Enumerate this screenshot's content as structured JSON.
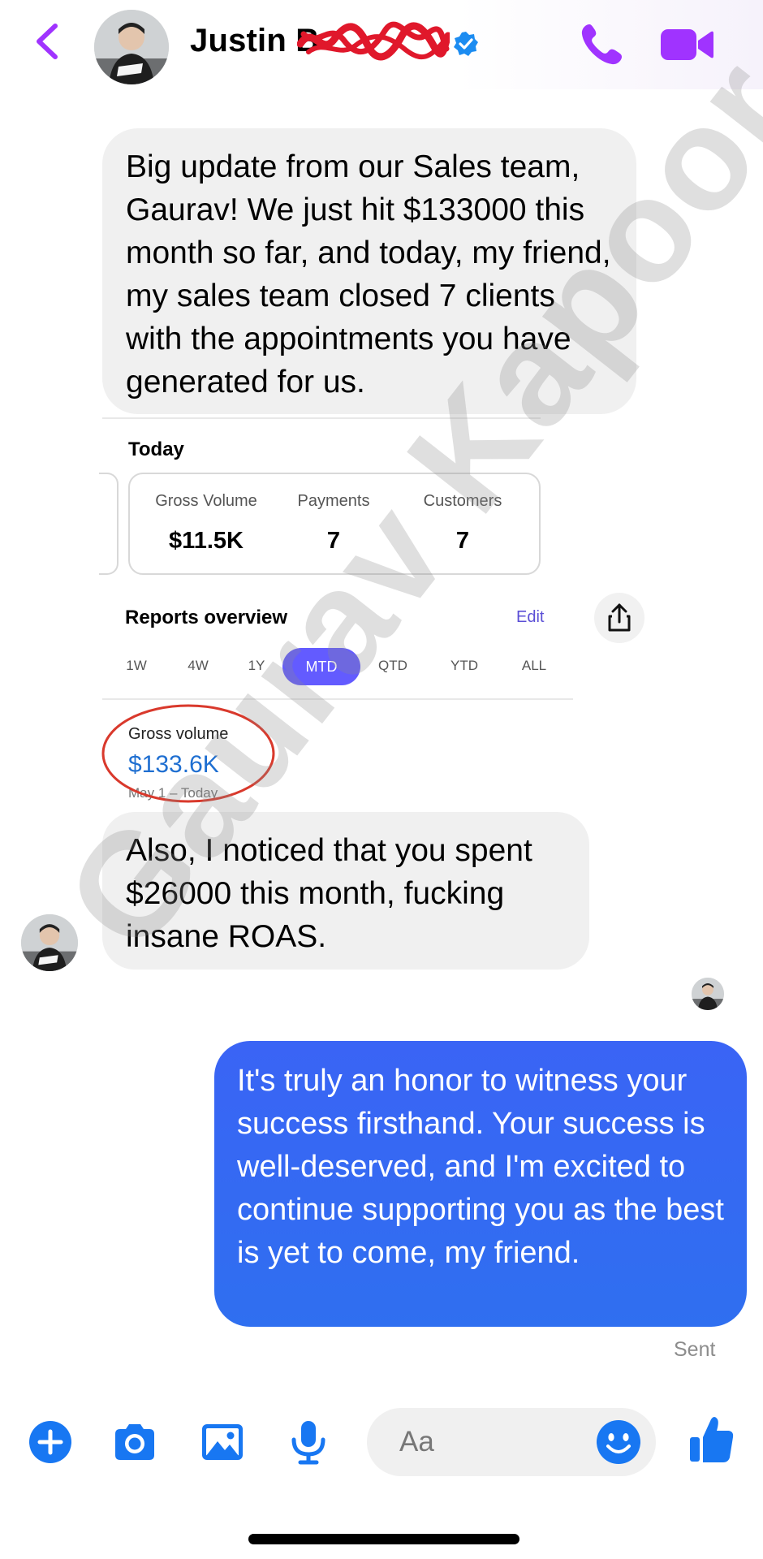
{
  "header": {
    "contact_name": "Justin B",
    "icons": [
      "back-chevron-icon",
      "verified-badge-icon",
      "phone-icon",
      "video-camera-icon"
    ]
  },
  "messages": {
    "incoming_1": "Big update from our Sales team, Gaurav! We just hit $133000 this month so far, and today, my friend, my sales team closed 7 clients with the appointments you have generated for us.",
    "incoming_2": "Also, I noticed that you spent $26000 this month, fucking insane ROAS.",
    "outgoing_1": "It's truly an honor to witness your success firsthand. Your success is well-deserved, and I'm excited to continue supporting you as the best is yet to come, my friend.",
    "status": "Sent"
  },
  "shared_card": {
    "today_title": "Today",
    "stats": [
      {
        "label": "Gross Volume",
        "value": "$11.5K"
      },
      {
        "label": "Payments",
        "value": "7"
      },
      {
        "label": "Customers",
        "value": "7"
      }
    ],
    "reports_title": "Reports overview",
    "edit_label": "Edit",
    "periods": [
      "1W",
      "4W",
      "1Y",
      "MTD",
      "QTD",
      "YTD",
      "ALL"
    ],
    "active_period": "MTD",
    "gross_volume_label": "Gross volume",
    "gross_volume_value": "$133.6K",
    "gross_volume_range": "May 1 – Today"
  },
  "watermark": "Gaurav Kapoor",
  "composer": {
    "placeholder": "Aa",
    "icons": [
      "plus-circle-icon",
      "camera-icon",
      "gallery-icon",
      "microphone-icon",
      "emoji-icon",
      "thumbs-up-icon"
    ]
  },
  "colors": {
    "accent_purple": "#a033ff",
    "outgoing_bubble": "#3b6af5",
    "incoming_bubble": "#f0f0f0",
    "composer_blue": "#1877f2",
    "active_period": "#635bff"
  }
}
